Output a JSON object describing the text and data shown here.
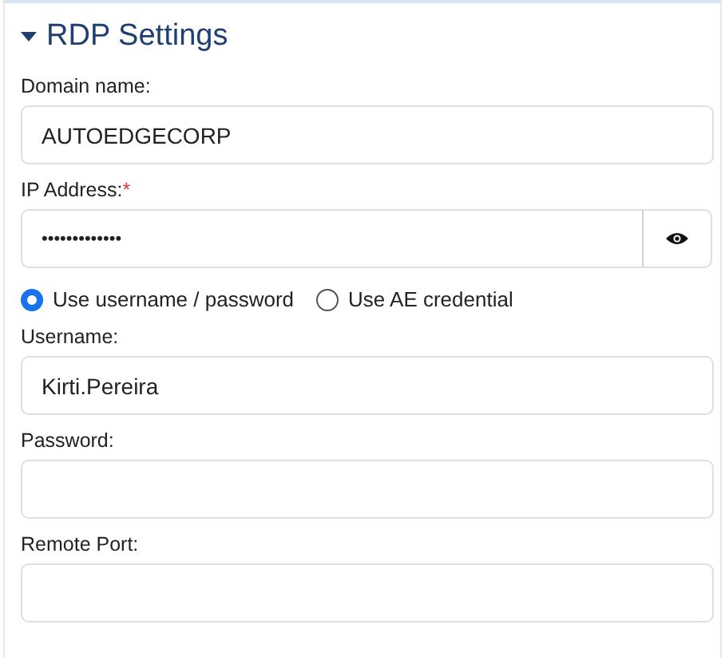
{
  "section": {
    "title": "RDP Settings",
    "expanded": true
  },
  "fields": [
    {
      "kind": "text",
      "label": "Domain name:",
      "value": "AUTOEDGECORP"
    },
    {
      "kind": "secret",
      "label": "IP Address:",
      "required_mark": "*",
      "value": "•••••••••••••"
    },
    {
      "kind": "radio",
      "options": [
        {
          "label": "Use username / password",
          "selected": true
        },
        {
          "label": "Use AE credential",
          "selected": false
        }
      ]
    },
    {
      "kind": "text",
      "label": "Username:",
      "value": "Kirti.Pereira"
    },
    {
      "kind": "text",
      "label": "Password:"
    },
    {
      "kind": "text",
      "label": "Remote Port:"
    }
  ]
}
